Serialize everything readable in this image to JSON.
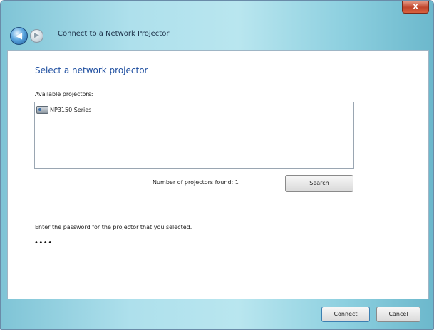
{
  "window": {
    "title": "Connect to a Network Projector",
    "close_glyph": "x",
    "back_glyph": "◀",
    "forward_glyph": "▶"
  },
  "page": {
    "heading": "Select a network projector",
    "available_label": "Available projectors:",
    "projectors": [
      {
        "name": "NP3150 Series",
        "icon": "projector-icon"
      }
    ],
    "found_text": "Number of projectors found: 1",
    "search_button": "Search",
    "password_label": "Enter the password for the projector that you selected.",
    "password_value": "••••"
  },
  "footer": {
    "connect_button": "Connect",
    "cancel_button": "Cancel"
  }
}
